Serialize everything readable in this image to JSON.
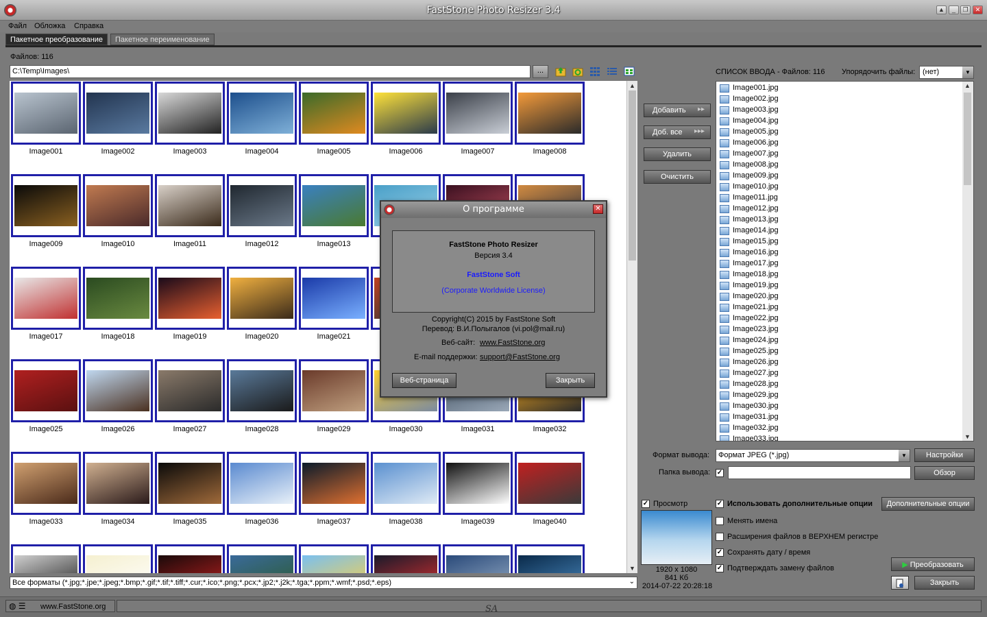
{
  "window": {
    "title": "FastStone Photo Resizer 3.4"
  },
  "menu": [
    "Файл",
    "Обложка",
    "Справка"
  ],
  "tabs": [
    {
      "label": "Пакетное преобразование",
      "active": true
    },
    {
      "label": "Пакетное переименование",
      "active": false
    }
  ],
  "browser": {
    "files_label": "Файлов: 116",
    "path": "C:\\Temp\\Images\\",
    "browse_label": "...",
    "filter": "Все форматы (*.jpg;*.jpe;*.jpeg;*.bmp;*.gif;*.tif;*.tiff;*.cur;*.ico;*.png;*.pcx;*.jp2;*.j2k;*.tga;*.ppm;*.wmf;*.psd;*.eps)"
  },
  "thumbnails": [
    "Image001",
    "Image002",
    "Image003",
    "Image004",
    "Image005",
    "Image006",
    "Image007",
    "Image008",
    "Image009",
    "Image010",
    "Image011",
    "Image012",
    "Image013",
    "",
    "",
    "",
    "Image017",
    "Image018",
    "Image019",
    "Image020",
    "Image021",
    "",
    "",
    "",
    "Image025",
    "Image026",
    "Image027",
    "Image028",
    "Image029",
    "Image030",
    "Image031",
    "Image032",
    "Image033",
    "Image034",
    "Image035",
    "Image036",
    "Image037",
    "Image038",
    "Image039",
    "Image040",
    "",
    "",
    "",
    "",
    "",
    "",
    "",
    ""
  ],
  "thumb_colors": [
    [
      "#b9c4cf",
      "#5a6470"
    ],
    [
      "#22344f",
      "#5a7aa0"
    ],
    [
      "#d8d8d8",
      "#222222"
    ],
    [
      "#1d4f8c",
      "#7fb0d8"
    ],
    [
      "#3a6a2a",
      "#e08a20"
    ],
    [
      "#ffe23a",
      "#2a3a4a"
    ],
    [
      "#3a3f48",
      "#c9ced6"
    ],
    [
      "#f39a3a",
      "#2a2a2a"
    ],
    [
      "#0a0a0a",
      "#8a6020"
    ],
    [
      "#c07a50",
      "#4a2a2a"
    ],
    [
      "#d8d0c8",
      "#3a2a1a"
    ],
    [
      "#202830",
      "#6a7888"
    ],
    [
      "#3a80c0",
      "#4a7a30"
    ],
    [
      "#4aa0c8",
      "#9ad0e8"
    ],
    [
      "#3a1020",
      "#c05060"
    ],
    [
      "#d08a40",
      "#2a3040"
    ],
    [
      "#e8e8e8",
      "#c03030"
    ],
    [
      "#2a4a20",
      "#6a8a40"
    ],
    [
      "#1a0a1a",
      "#e86030"
    ],
    [
      "#f0b040",
      "#3a2a1a"
    ],
    [
      "#1a3aa8",
      "#7ab0ff"
    ],
    [
      "#c04020",
      "#3a3a3a"
    ],
    [
      "#80b0d8",
      "#2a3a5a"
    ],
    [
      "#e0a040",
      "#3a2a2a"
    ],
    [
      "#b02020",
      "#5a1010"
    ],
    [
      "#c0d8f0",
      "#4a3020"
    ],
    [
      "#8a7a6a",
      "#2a2a2a"
    ],
    [
      "#5a7a9a",
      "#1a1a1a"
    ],
    [
      "#6a3a2a",
      "#c0a080"
    ],
    [
      "#ffd030",
      "#7a8aa0"
    ],
    [
      "#3a4a5a",
      "#9aa8b8"
    ],
    [
      "#ffb020",
      "#2a2a2a"
    ],
    [
      "#d0a070",
      "#4a2a1a"
    ],
    [
      "#d0b090",
      "#2a1a1a"
    ],
    [
      "#0a0a0a",
      "#a06a3a"
    ],
    [
      "#5a8ad0",
      "#e8f0f8"
    ],
    [
      "#0a1a2a",
      "#e07030"
    ],
    [
      "#5a90d0",
      "#dfeaf5"
    ],
    [
      "#101010",
      "#ffffff"
    ],
    [
      "#c02020",
      "#3a3a3a"
    ],
    [
      "#cfcfcf",
      "#1a1a1a"
    ],
    [
      "#f5f0d0",
      "#ffffff"
    ],
    [
      "#1a0a0a",
      "#c02020"
    ],
    [
      "#3a6a9a",
      "#2a5a2a"
    ],
    [
      "#7ac0f0",
      "#ffd040"
    ],
    [
      "#1a1a2a",
      "#e03030"
    ],
    [
      "#2a4a7a",
      "#9ab0c8"
    ],
    [
      "#0a2a4a",
      "#4a8ac0"
    ]
  ],
  "actions": {
    "add": "Добавить",
    "add_all": "Доб. все",
    "remove": "Удалить",
    "clear": "Очистить"
  },
  "input_list": {
    "header": "СПИСОК ВВОДА  -  Файлов: 116",
    "sort_label": "Упорядочить файлы:",
    "sort_value": "(нет)",
    "files": [
      "Image001.jpg",
      "Image002.jpg",
      "Image003.jpg",
      "Image004.jpg",
      "Image005.jpg",
      "Image006.jpg",
      "Image007.jpg",
      "Image008.jpg",
      "Image009.jpg",
      "Image010.jpg",
      "Image011.jpg",
      "Image012.jpg",
      "Image013.jpg",
      "Image014.jpg",
      "Image015.jpg",
      "Image016.jpg",
      "Image017.jpg",
      "Image018.jpg",
      "Image019.jpg",
      "Image020.jpg",
      "Image021.jpg",
      "Image022.jpg",
      "Image023.jpg",
      "Image024.jpg",
      "Image025.jpg",
      "Image026.jpg",
      "Image027.jpg",
      "Image028.jpg",
      "Image029.jpg",
      "Image030.jpg",
      "Image031.jpg",
      "Image032.jpg",
      "Image033.jpg"
    ]
  },
  "output": {
    "format_label": "Формат вывода:",
    "format_value": "Формат JPEG (*.jpg)",
    "settings": "Настройки",
    "folder_label": "Папка вывода:",
    "folder_value": "",
    "browse": "Обзор"
  },
  "preview": {
    "label": "Просмотр",
    "dims": "1920 x 1080",
    "size": "841 Кб",
    "date": "2014-07-22 20:28:18"
  },
  "options": {
    "use_advanced": "Использовать дополнительные опции",
    "advanced_btn": "Дополнительные опции",
    "rename": "Менять имена",
    "upper_ext": "Расширения файлов в ВЕРХНЕМ регистре",
    "keep_date": "Сохранять дату / время",
    "confirm": "Подтверждать замену файлов"
  },
  "buttons": {
    "convert": "Преобразовать",
    "close": "Закрыть"
  },
  "status": {
    "site": "www.FastStone.org",
    "watermark": "SA"
  },
  "about": {
    "title": "О программе",
    "product": "FastStone Photo Resizer",
    "version": "Версия 3.4",
    "company": "FastStone Soft",
    "license": "(Corporate Worldwide License)",
    "copyright": "Copyright(C) 2015 by FastStone Soft",
    "translation": "Перевод: В.И.Полыгалов (vi.pol@mail.ru)",
    "website_label": "Веб-сайт:",
    "website": "www.FastStone.org",
    "email_label": "E-mail поддержки:",
    "email": "support@FastStone.org",
    "web_btn": "Веб-страница",
    "close_btn": "Закрыть"
  },
  "colors": {
    "accent": "#1f1fa8",
    "link": "#1a1aff",
    "convert_icon": "#2ecc40"
  }
}
